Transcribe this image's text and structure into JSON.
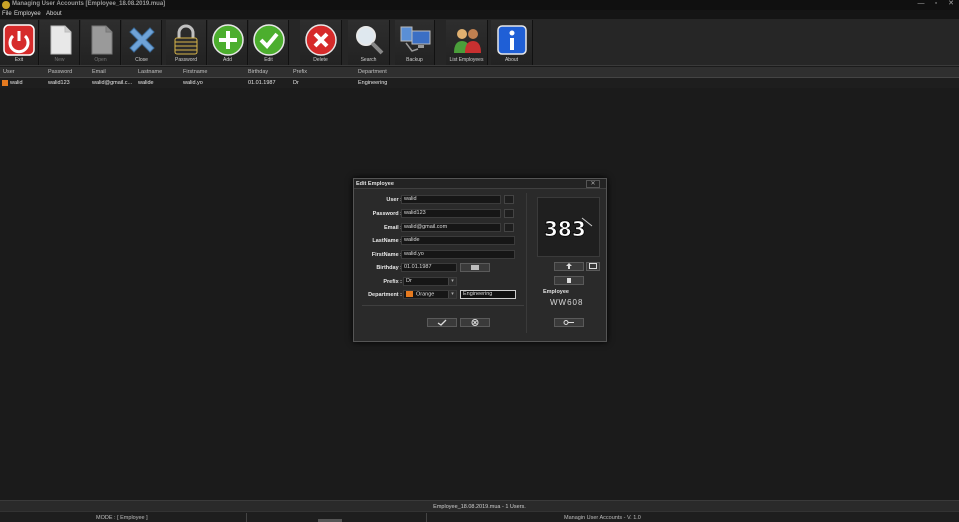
{
  "window": {
    "title": "Managing User Accounts [Employee_18.08.2019.mua]"
  },
  "menu": {
    "items": [
      "File",
      "Employee",
      "About"
    ]
  },
  "toolbar": {
    "buttons": [
      {
        "label": "Exit",
        "icon": "power-icon",
        "enabled": true
      },
      {
        "label": "New",
        "icon": "new-file-icon",
        "enabled": false
      },
      {
        "label": "Open",
        "icon": "open-file-icon",
        "enabled": false
      },
      {
        "label": "Close",
        "icon": "close-x-icon",
        "enabled": true
      },
      {
        "label": "Password",
        "icon": "padlock-icon",
        "enabled": true
      },
      {
        "label": "Add",
        "icon": "plus-icon",
        "enabled": true
      },
      {
        "label": "Edit",
        "icon": "checkmark-icon",
        "enabled": true
      },
      {
        "label": "Delete",
        "icon": "delete-icon",
        "enabled": true
      },
      {
        "label": "Search",
        "icon": "magnifier-icon",
        "enabled": true
      },
      {
        "label": "Backup",
        "icon": "backup-icon",
        "enabled": true
      },
      {
        "label": "List Employees",
        "icon": "users-icon",
        "enabled": true
      },
      {
        "label": "About",
        "icon": "info-icon",
        "enabled": true
      }
    ]
  },
  "grid": {
    "columns": [
      "User",
      "Password",
      "Email",
      "Lastname",
      "Firstname",
      "Birthday",
      "Prefix",
      "Department"
    ],
    "rows": [
      {
        "user": "walid",
        "password": "walid123",
        "email": "walid@gmail.c...",
        "lastname": "walide",
        "firstname": "walid.yo",
        "birthday": "01.01.1987",
        "prefix": "Dr",
        "department": "Engineering",
        "color": "#e57a1f"
      }
    ]
  },
  "dialog": {
    "title": "Edit Employee",
    "close_label": "✕",
    "labels": {
      "user": "User :",
      "password": "Password :",
      "email": "Email :",
      "lastname": "LastName :",
      "firstname": "FirstName :",
      "birthday": "Birthday :",
      "prefix": "Prefix :",
      "department": "Department :"
    },
    "values": {
      "user": "walid",
      "password": "walid123",
      "email": "walid@gmail.com",
      "lastname": "walide",
      "firstname": "walid.yo",
      "birthday": "01.01.1987",
      "prefix": "Dr",
      "department_color": "Orange",
      "department": "Engineering"
    },
    "photo_text": "383",
    "employee_label": "Employee",
    "employee_code": "WW608",
    "accent_color": "#e57a1f"
  },
  "status": {
    "file_info": "Employee_18.08.2019.mua - 1 Users.",
    "mode": "MODE : [ Employee ]",
    "app_version": "Managin User Accounts - V. 1.0"
  }
}
